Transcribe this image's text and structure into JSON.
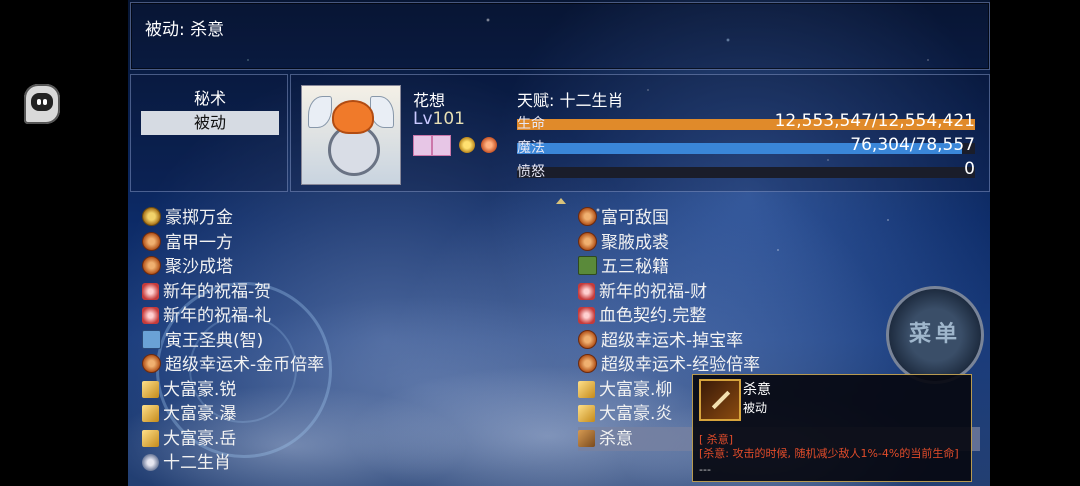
{
  "header": {
    "title": "被动: 杀意"
  },
  "side_tabs": [
    {
      "label": "秘术"
    },
    {
      "label": "被动"
    }
  ],
  "character": {
    "name": "花想",
    "level_prefix": "Lv",
    "level": "101",
    "talent": "天赋: 十二生肖",
    "hp": {
      "label": "生命",
      "value": "12,553,547/12,554,421",
      "fraction": 0.99993,
      "color": "#e08a2a"
    },
    "mp": {
      "label": "魔法",
      "value": "76,304/78,557",
      "fraction": 0.971,
      "color": "#3a86d8"
    },
    "rage": {
      "label": "愤怒",
      "value": "0",
      "fraction": 0,
      "color": "#6a3a9a"
    }
  },
  "skills_left": [
    {
      "label": "豪掷万金",
      "icon": "coin"
    },
    {
      "label": "富甲一方",
      "icon": "gear"
    },
    {
      "label": "聚沙成塔",
      "icon": "gear"
    },
    {
      "label": "新年的祝福-贺",
      "icon": "star"
    },
    {
      "label": "新年的祝福-礼",
      "icon": "star"
    },
    {
      "label": "寅王圣典(智)",
      "icon": "blue"
    },
    {
      "label": "超级幸运术-金币倍率",
      "icon": "gear"
    },
    {
      "label": "大富豪.锐",
      "icon": "gold"
    },
    {
      "label": "大富豪.瀑",
      "icon": "gold"
    },
    {
      "label": "大富豪.岳",
      "icon": "gold"
    },
    {
      "label": "十二生肖",
      "icon": "flower"
    }
  ],
  "skills_right": [
    {
      "label": "富可敌国",
      "icon": "gear"
    },
    {
      "label": "聚腋成裘",
      "icon": "gear"
    },
    {
      "label": "五三秘籍",
      "icon": "book"
    },
    {
      "label": "新年的祝福-财",
      "icon": "star"
    },
    {
      "label": "血色契约.完整",
      "icon": "star"
    },
    {
      "label": "超级幸运术-掉宝率",
      "icon": "gear"
    },
    {
      "label": "超级幸运术-经验倍率",
      "icon": "gear"
    },
    {
      "label": "大富豪.柳",
      "icon": "gold"
    },
    {
      "label": "大富豪.炎",
      "icon": "gold"
    },
    {
      "label": "杀意",
      "icon": "sword",
      "selected": true
    }
  ],
  "menu_button": {
    "label": "菜单"
  },
  "tooltip": {
    "title": "杀意",
    "subtitle": "被动",
    "line1": "[ 杀意]",
    "line2": "[杀意: 攻击的时候, 随机减少敌人1%-4%的当前生命]",
    "line3": "---"
  }
}
